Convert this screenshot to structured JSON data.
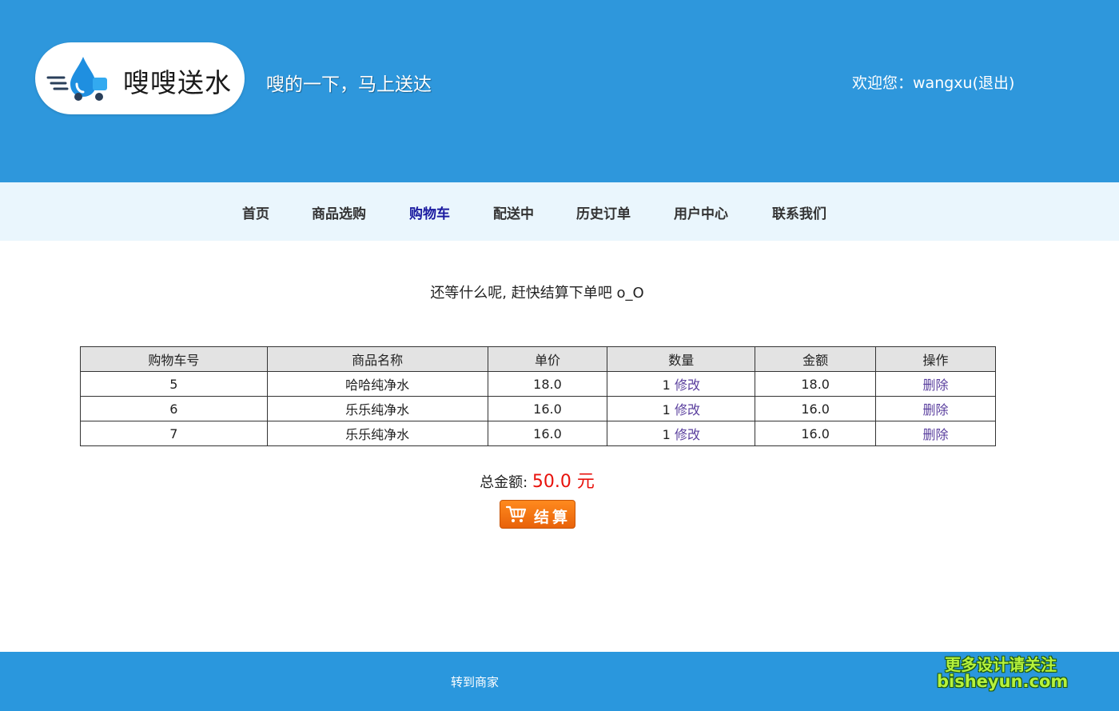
{
  "header": {
    "logo_text": "嗖嗖送水",
    "slogan": "嗖的一下，马上送达",
    "welcome_prefix": "欢迎您：",
    "username": "wangxu",
    "logout_label": "(退出)"
  },
  "nav": {
    "items": [
      {
        "label": "首页"
      },
      {
        "label": "商品选购"
      },
      {
        "label": "购物车",
        "active": true
      },
      {
        "label": "配送中"
      },
      {
        "label": "历史订单"
      },
      {
        "label": "用户中心"
      },
      {
        "label": "联系我们"
      }
    ]
  },
  "main": {
    "prompt": "还等什么呢, 赶快结算下单吧 o_O",
    "table": {
      "headers": [
        "购物车号",
        "商品名称",
        "单价",
        "数量",
        "金额",
        "操作"
      ],
      "rows": [
        {
          "id": "5",
          "name": "哈哈纯净水",
          "price": "18.0",
          "qty": "1",
          "edit": "修改",
          "amount": "18.0",
          "delete": "删除"
        },
        {
          "id": "6",
          "name": "乐乐纯净水",
          "price": "16.0",
          "qty": "1",
          "edit": "修改",
          "amount": "16.0",
          "delete": "删除"
        },
        {
          "id": "7",
          "name": "乐乐纯净水",
          "price": "16.0",
          "qty": "1",
          "edit": "修改",
          "amount": "16.0",
          "delete": "删除"
        }
      ]
    },
    "total_label": "总金额: ",
    "total_amount": "50.0 元",
    "checkout_label": "结算"
  },
  "footer": {
    "link_label": "转到商家"
  },
  "watermark": {
    "line1": "更多设计请关注",
    "line2": "bisheyun.com"
  },
  "colors": {
    "header_bg": "#2e97dc",
    "nav_bg": "#eaf6fd",
    "nav_active": "#1a1aa0",
    "total_amount": "#e8120c",
    "checkout_bg": "#f27313",
    "link": "#5a3f9e"
  }
}
